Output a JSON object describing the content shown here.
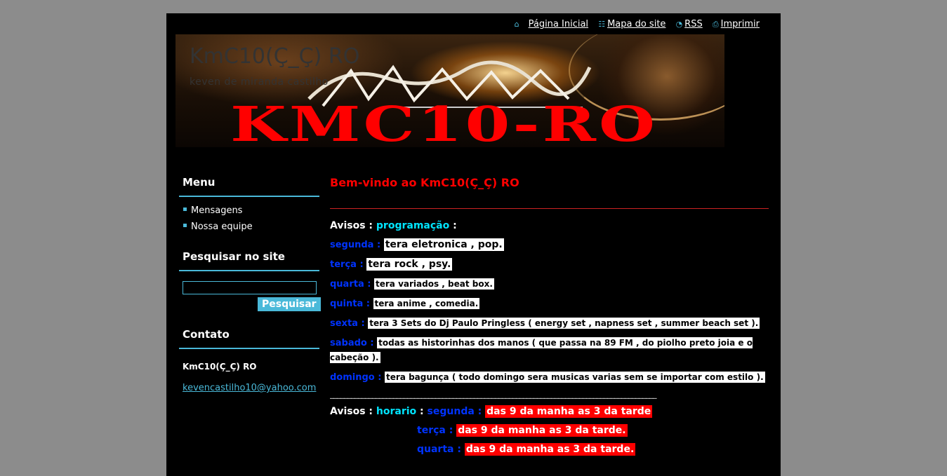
{
  "toplinks": [
    {
      "icon": "home-icon",
      "label": "Página Inicial"
    },
    {
      "icon": "sitemap-icon",
      "label": "Mapa do site"
    },
    {
      "icon": "rss-icon",
      "label": "RSS"
    },
    {
      "icon": "print-icon",
      "label": "Imprimir"
    }
  ],
  "header": {
    "title": "KmC10(Ç_Ç) RO",
    "subtitle": "keven de miranda castilho",
    "logo_text": "KMC10-RO"
  },
  "sidebar": {
    "menu_heading": "Menu",
    "menu_items": [
      "Mensagens",
      "Nossa equipe"
    ],
    "search_heading": "Pesquisar no site",
    "search_value": "",
    "search_button": "Pesquisar",
    "contact_heading": "Contato",
    "contact_name": "KmC10(Ç_Ç) RO",
    "contact_email": "kevencastilho10@yahoo.com"
  },
  "main": {
    "welcome": "Bem-vindo ao KmC10(Ç_Ç) RO",
    "avisos1": {
      "prefix": "Avisos",
      "sep": " : ",
      "highlight": "programação",
      "suffix": " :"
    },
    "programacao": [
      {
        "day": "segunda",
        "value": "tera eletronica , pop."
      },
      {
        "day": "terça",
        "value": "tera rock , psy."
      },
      {
        "day": "quarta",
        "value": "tera variados , beat box."
      },
      {
        "day": "quinta",
        "value": "tera anime , comedia."
      },
      {
        "day": "sexta",
        "value": "tera 3 Sets do Dj Paulo Pringless ( energy set , napness set , summer beach set )."
      },
      {
        "day": "sabado",
        "value": "todas as historinhas dos manos ( que passa na 89 FM , do piolho preto joia e o cabeção )."
      },
      {
        "day": "domingo",
        "value": "tera bagunça ( todo domingo sera musicas varias sem se importar com estilo )."
      }
    ],
    "divider": "_____________________________________________________________________________________________",
    "avisos2": {
      "prefix": "Avisos",
      "sep": " : ",
      "highlight": "horario",
      "suffix": " : "
    },
    "horario": [
      {
        "day": "segunda",
        "value": "das 9 da manha as 3 da tarde"
      },
      {
        "day": "terça",
        "value": "das 9 da manha as 3 da tarde."
      },
      {
        "day": "quarta",
        "value": "das 9 da manha as 3 da tarde."
      }
    ]
  },
  "colors": {
    "accent": "#4ab9d9",
    "red": "#ff0000",
    "blue": "#0033ff",
    "cyan": "#00e5ff",
    "page_bg": "#8c8c8c"
  }
}
